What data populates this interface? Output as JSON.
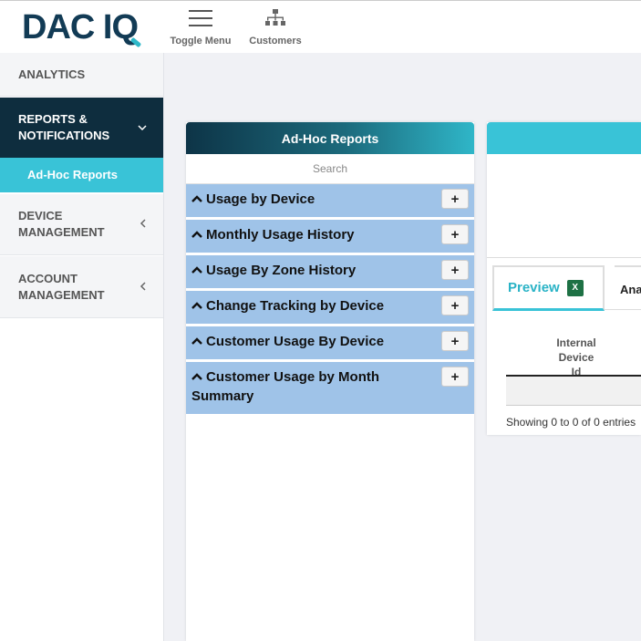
{
  "brand": {
    "logo_text": "DAC IQ",
    "accent": "#2eb8c9",
    "navy": "#123b55"
  },
  "toolbar": {
    "toggle_menu_label": "Toggle Menu",
    "toggle_menu_icon": "hamburger-icon",
    "customers_label": "Customers",
    "customers_icon": "org-chart-icon"
  },
  "sidebar": {
    "items": [
      {
        "label": "ANALYTICS"
      },
      {
        "label": "REPORTS & NOTIFICATIONS",
        "icon": "chevron-down-icon"
      },
      {
        "label": "Ad-Hoc Reports"
      },
      {
        "label": "DEVICE MANAGEMENT",
        "icon": "chevron-left-icon"
      },
      {
        "label": "ACCOUNT MANAGEMENT",
        "icon": "chevron-left-icon"
      }
    ]
  },
  "adhoc": {
    "title": "Ad-Hoc Reports",
    "search_placeholder": "Search",
    "reports": [
      {
        "label": "Usage by Device"
      },
      {
        "label": "Monthly Usage History"
      },
      {
        "label": "Usage By Zone History"
      },
      {
        "label": "Change Tracking by Device"
      },
      {
        "label": "Customer Usage By Device"
      },
      {
        "label": "Customer Usage by Month Summary"
      }
    ],
    "add_label": "+"
  },
  "preview": {
    "tab_preview": "Preview",
    "excel_icon": "excel-icon",
    "tab_other": "Ana",
    "column_header": "Internal Device Id",
    "footer_text": "Showing 0 to 0 of 0 entries"
  }
}
